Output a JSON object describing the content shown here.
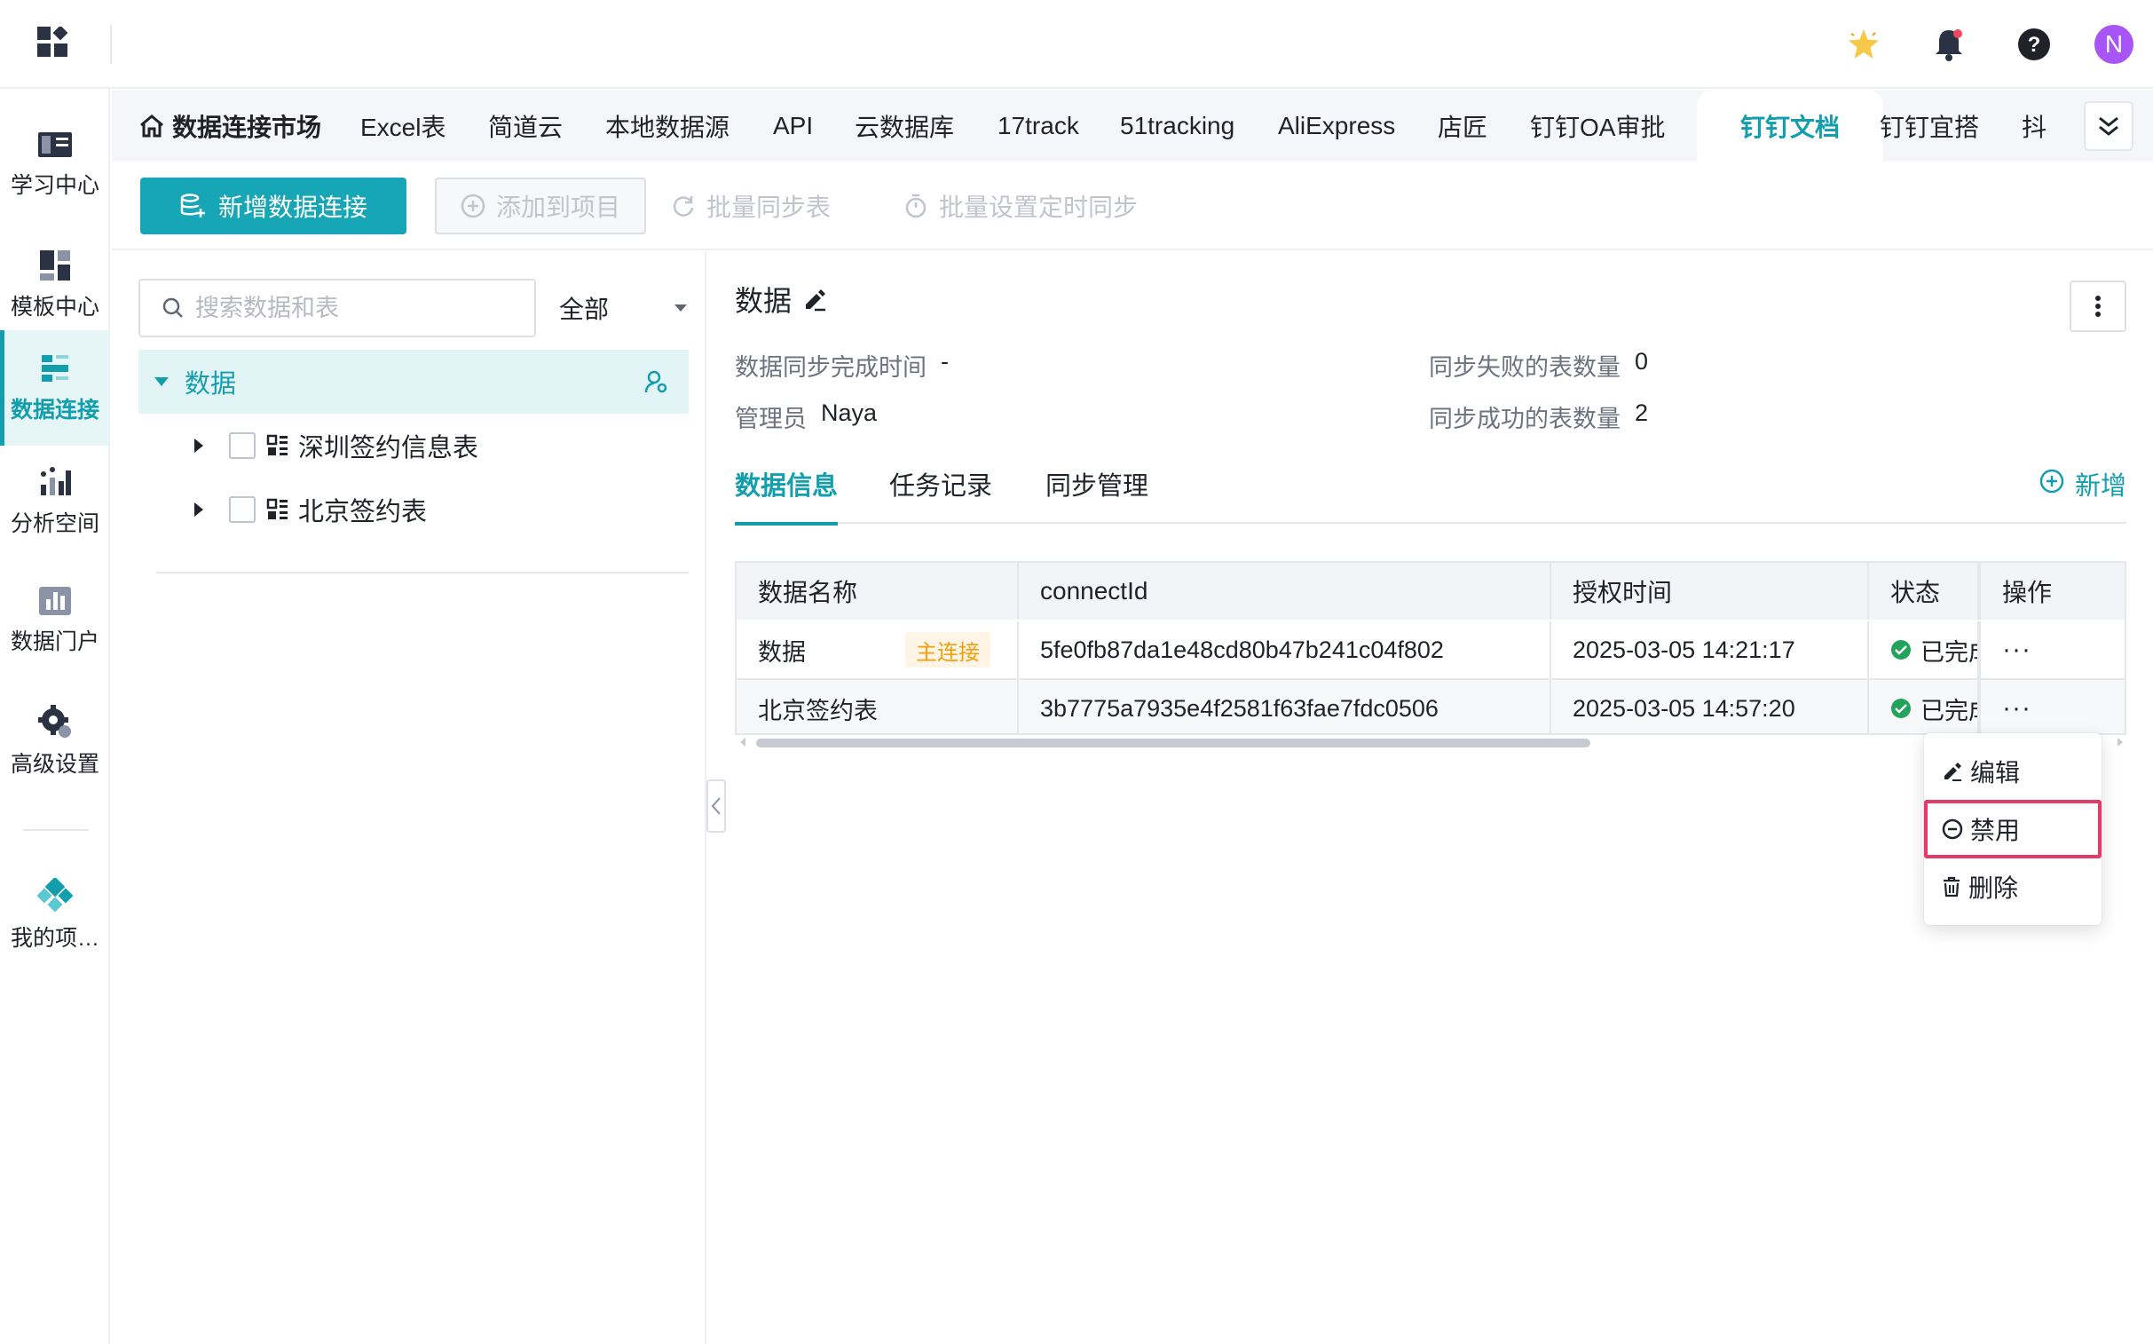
{
  "topbar": {
    "icons": [
      "apps-grid-icon",
      "star-icon",
      "bell-icon",
      "help-icon"
    ],
    "avatar_initial": "N",
    "colors": {
      "accent": "#16a6b6",
      "avatar": "#a855f7"
    }
  },
  "sidebar": {
    "items": [
      {
        "label": "学习中心",
        "icon": "learning-icon"
      },
      {
        "label": "模板中心",
        "icon": "template-icon"
      },
      {
        "label": "数据连接",
        "icon": "data-connection-icon",
        "active": true
      },
      {
        "label": "分析空间",
        "icon": "analysis-icon"
      },
      {
        "label": "数据门户",
        "icon": "portal-icon"
      },
      {
        "label": "高级设置",
        "icon": "settings-icon"
      },
      {
        "label": "我的项…",
        "icon": "project-icon"
      }
    ]
  },
  "tabs": {
    "home": "数据连接市场",
    "items": [
      "Excel表",
      "简道云",
      "本地数据源",
      "API",
      "云数据库",
      "17track",
      "51tracking",
      "AliExpress",
      "店匠",
      "钉钉OA审批",
      "钉钉文档",
      "钉钉宜搭",
      "抖"
    ],
    "active": "钉钉文档"
  },
  "toolbar": {
    "new_connection": "新增数据连接",
    "add_to_project": "添加到项目",
    "batch_sync": "批量同步表",
    "batch_schedule": "批量设置定时同步"
  },
  "tree": {
    "search_placeholder": "搜索数据和表",
    "filter_value": "全部",
    "root": "数据",
    "children": [
      "深圳签约信息表",
      "北京签约表"
    ]
  },
  "detail": {
    "title": "数据",
    "sync_time_label": "数据同步完成时间",
    "sync_time_value": "-",
    "admin_label": "管理员",
    "admin_value": "Naya",
    "failed_label": "同步失败的表数量",
    "failed_value": "0",
    "success_label": "同步成功的表数量",
    "success_value": "2",
    "subtabs": [
      "数据信息",
      "任务记录",
      "同步管理"
    ],
    "add_label": "新增"
  },
  "table": {
    "headers": [
      "数据名称",
      "connectId",
      "授权时间",
      "状态",
      "操作"
    ],
    "main_tag": "主连接",
    "rows": [
      {
        "name": "数据",
        "connect_id": "5fe0fb87da1e48cd80b47b241c04f802",
        "time": "2025-03-05 14:21:17",
        "status": "已完成",
        "actions": "···"
      },
      {
        "name": "北京签约表",
        "connect_id": "3b7775a7935e4f2581f63fae7fdc0506",
        "time": "2025-03-05 14:57:20",
        "status": "已完成",
        "actions": "···"
      }
    ]
  },
  "menu": {
    "items": [
      "编辑",
      "禁用",
      "删除"
    ],
    "highlighted": "禁用"
  }
}
